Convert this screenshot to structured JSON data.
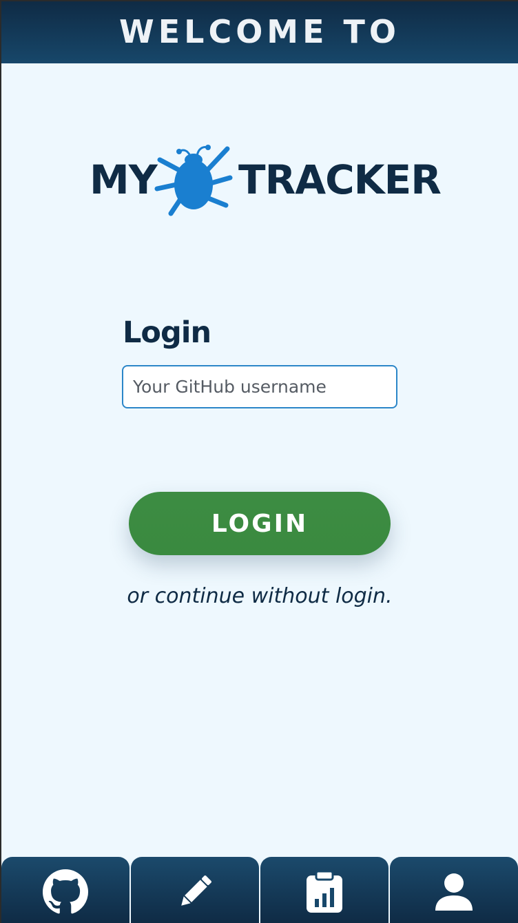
{
  "header": {
    "title": "WELCOME TO"
  },
  "logo": {
    "text_left": "MY",
    "text_right": "TRACKER",
    "icon": "bug-icon",
    "bug_color": "#1a7fd0"
  },
  "login": {
    "heading": "Login",
    "username_placeholder": "Your GitHub username",
    "username_value": "",
    "button_label": "LOGIN",
    "continue_text": "or continue without login."
  },
  "bottom_nav": {
    "items": [
      {
        "icon": "github-icon"
      },
      {
        "icon": "pencil-icon"
      },
      {
        "icon": "clipboard-chart-icon"
      },
      {
        "icon": "user-icon"
      }
    ]
  },
  "colors": {
    "header_bg": "#0f2b45",
    "page_bg": "#eef8fe",
    "primary_text": "#0f2b45",
    "button_green": "#3d8c43",
    "input_border": "#2b86c8"
  }
}
